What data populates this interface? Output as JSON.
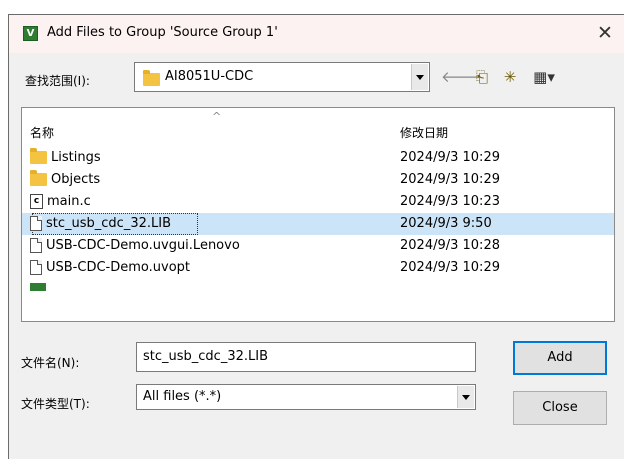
{
  "window": {
    "title": "Add Files to Group 'Source Group 1'",
    "close_glyph": "✕",
    "app_icon_glyph": "V"
  },
  "look_in": {
    "label": "查找范围(I):",
    "value": "AI8051U-CDC",
    "icon": "folder-icon"
  },
  "toolbar": {
    "back": "🡐",
    "up_folder": "⎗",
    "new_folder": "✳",
    "view_menu": "▦▾"
  },
  "list": {
    "columns": {
      "name": "名称",
      "date": "修改日期"
    },
    "sort_caret": "^",
    "rows": [
      {
        "name": "Listings",
        "date": "2024/9/3 10:29",
        "icon": "folder-icon"
      },
      {
        "name": "Objects",
        "date": "2024/9/3 10:29",
        "icon": "folder-icon"
      },
      {
        "name": "main.c",
        "date": "2024/9/3 10:23",
        "icon": "c-file-icon"
      },
      {
        "name": "stc_usb_cdc_32.LIB",
        "date": "2024/9/3 9:50",
        "icon": "file-icon",
        "selected": true
      },
      {
        "name": "USB-CDC-Demo.uvgui.Lenovo",
        "date": "2024/9/3 10:28",
        "icon": "file-icon"
      },
      {
        "name": "USB-CDC-Demo.uvopt",
        "date": "2024/9/3 10:29",
        "icon": "file-icon"
      }
    ]
  },
  "file_name": {
    "label": "文件名(N):",
    "value": "stc_usb_cdc_32.LIB"
  },
  "file_type": {
    "label": "文件类型(T):",
    "value": "All files (*.*)"
  },
  "buttons": {
    "add": "Add",
    "close": "Close"
  },
  "colors": {
    "selection": "#cce4f7",
    "folder": "#f5c342",
    "default_button_border": "#0078d7"
  }
}
